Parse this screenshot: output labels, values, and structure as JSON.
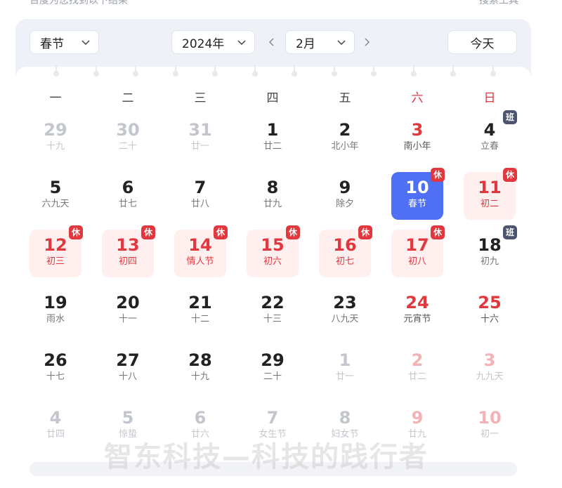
{
  "page": {
    "caption": "百度为您找到以下结果",
    "search_tools": "搜索工具"
  },
  "toolbar": {
    "festival_select": "春节",
    "year_select": "2024年",
    "month_select": "2月",
    "today_button": "今天",
    "prev_icon": "chevron-left-icon",
    "next_icon": "chevron-right-icon"
  },
  "weekdays": [
    "一",
    "二",
    "三",
    "四",
    "五",
    "六",
    "日"
  ],
  "days": [
    {
      "num": "29",
      "lunar": "十九",
      "dim": true
    },
    {
      "num": "30",
      "lunar": "二十",
      "dim": true
    },
    {
      "num": "31",
      "lunar": "廿一",
      "dim": true
    },
    {
      "num": "1",
      "lunar": "廿二"
    },
    {
      "num": "2",
      "lunar": "北小年"
    },
    {
      "num": "3",
      "lunar": "南小年",
      "red": true
    },
    {
      "num": "4",
      "lunar": "立春",
      "badge": "班"
    },
    {
      "num": "5",
      "lunar": "六九天"
    },
    {
      "num": "6",
      "lunar": "廿七"
    },
    {
      "num": "7",
      "lunar": "廿八"
    },
    {
      "num": "8",
      "lunar": "廿九"
    },
    {
      "num": "9",
      "lunar": "除夕"
    },
    {
      "num": "10",
      "lunar": "春节",
      "selected": true,
      "badge": "休"
    },
    {
      "num": "11",
      "lunar": "初二",
      "holiday": true,
      "badge": "休"
    },
    {
      "num": "12",
      "lunar": "初三",
      "holiday": true,
      "badge": "休"
    },
    {
      "num": "13",
      "lunar": "初四",
      "holiday": true,
      "badge": "休"
    },
    {
      "num": "14",
      "lunar": "情人节",
      "holiday": true,
      "badge": "休"
    },
    {
      "num": "15",
      "lunar": "初六",
      "holiday": true,
      "badge": "休"
    },
    {
      "num": "16",
      "lunar": "初七",
      "holiday": true,
      "badge": "休"
    },
    {
      "num": "17",
      "lunar": "初八",
      "holiday": true,
      "badge": "休"
    },
    {
      "num": "18",
      "lunar": "初九",
      "badge": "班"
    },
    {
      "num": "19",
      "lunar": "雨水"
    },
    {
      "num": "20",
      "lunar": "十一"
    },
    {
      "num": "21",
      "lunar": "十二"
    },
    {
      "num": "22",
      "lunar": "十三"
    },
    {
      "num": "23",
      "lunar": "八九天"
    },
    {
      "num": "24",
      "lunar": "元宵节",
      "red": true
    },
    {
      "num": "25",
      "lunar": "十六",
      "red": true
    },
    {
      "num": "26",
      "lunar": "十七"
    },
    {
      "num": "27",
      "lunar": "十八"
    },
    {
      "num": "28",
      "lunar": "十九"
    },
    {
      "num": "29",
      "lunar": "二十"
    },
    {
      "num": "1",
      "lunar": "廿一",
      "dim": true
    },
    {
      "num": "2",
      "lunar": "廿二",
      "dim": true,
      "red": true
    },
    {
      "num": "3",
      "lunar": "九九天",
      "dim": true,
      "red": true
    },
    {
      "num": "4",
      "lunar": "廿四",
      "dim": true
    },
    {
      "num": "5",
      "lunar": "惊蛰",
      "dim": true
    },
    {
      "num": "6",
      "lunar": "廿六",
      "dim": true
    },
    {
      "num": "7",
      "lunar": "女生节",
      "dim": true
    },
    {
      "num": "8",
      "lunar": "妇女节",
      "dim": true
    },
    {
      "num": "9",
      "lunar": "廿九",
      "dim": true,
      "red": true
    },
    {
      "num": "10",
      "lunar": "初一",
      "dim": true,
      "red": true
    }
  ],
  "watermark": "智东科技—科技的践行者",
  "colors": {
    "accent": "#4f6ff4",
    "holiday_red": "#e0383e",
    "work_badge": "#4c5470",
    "holiday_bg": "#fff0ef"
  }
}
